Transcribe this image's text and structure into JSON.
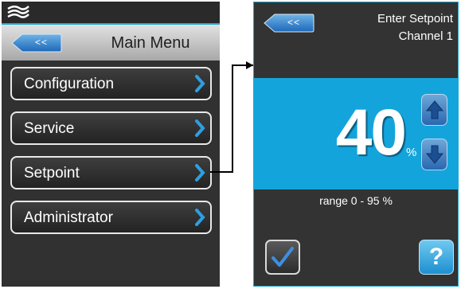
{
  "main_menu": {
    "back_label": "<<",
    "title": "Main Menu",
    "items": [
      {
        "label": "Configuration"
      },
      {
        "label": "Service"
      },
      {
        "label": "Setpoint"
      },
      {
        "label": "Administrator"
      }
    ]
  },
  "setpoint": {
    "back_label": "<<",
    "title": "Enter Setpoint",
    "channel": "Channel 1",
    "value": "40",
    "unit": "%",
    "range": "range 0 - 95 %",
    "help_label": "?"
  },
  "colors": {
    "accent": "#14a4dc",
    "panel_bg": "#313131"
  },
  "icons": [
    "logo-icon",
    "back-arrow-icon",
    "chevron-right-icon",
    "arrow-up-icon",
    "arrow-down-icon",
    "checkmark-icon",
    "help-icon"
  ]
}
